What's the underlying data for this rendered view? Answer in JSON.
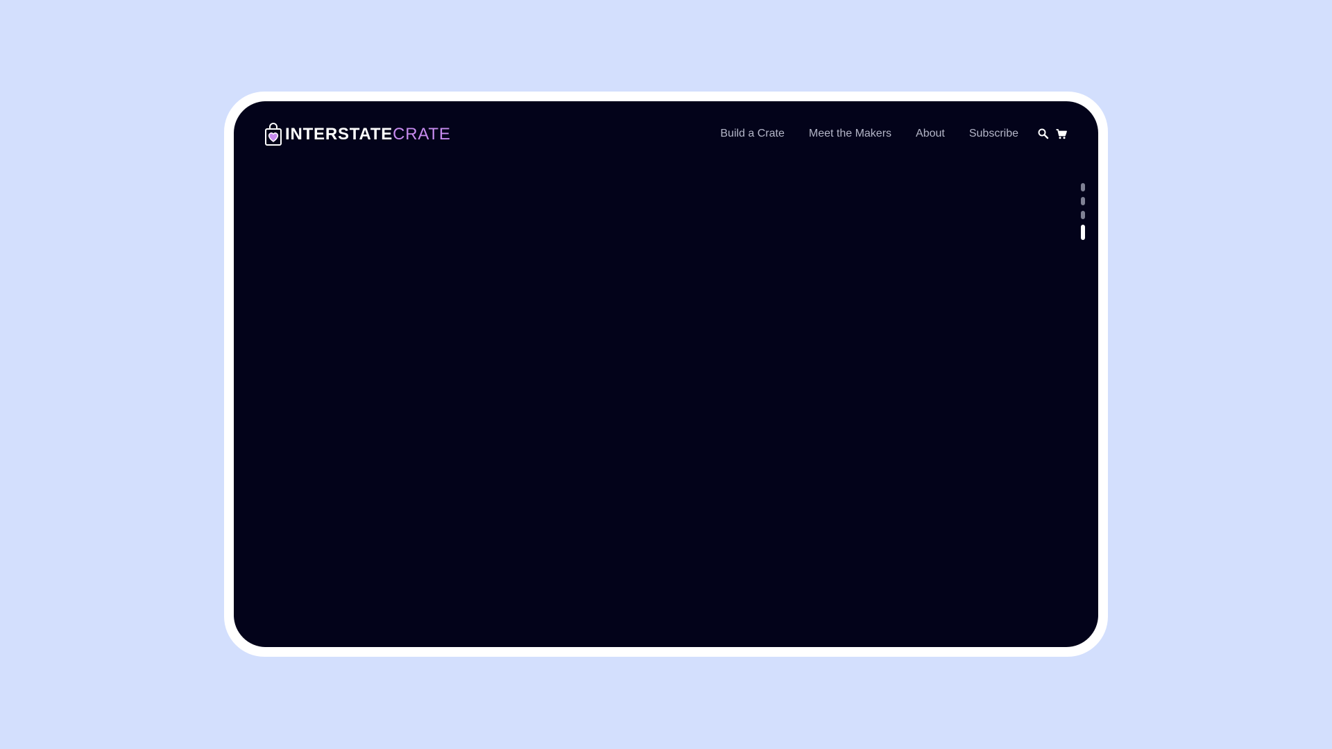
{
  "brand": {
    "name_bold": "INTERSTATE",
    "name_light": "CRATE",
    "logo_icon": "shopping-bag-heart-icon",
    "accent_color": "#c78bef"
  },
  "nav": {
    "links": [
      {
        "label": "Build a Crate"
      },
      {
        "label": "Meet the Makers"
      },
      {
        "label": "About"
      },
      {
        "label": "Subscribe"
      }
    ],
    "icons": [
      "search-icon",
      "cart-icon"
    ]
  },
  "pager": {
    "total": 4,
    "active_index": 3
  },
  "colors": {
    "page_background": "#d3dffd",
    "screen_background": "#03031a",
    "nav_text": "#b4b6c8"
  }
}
